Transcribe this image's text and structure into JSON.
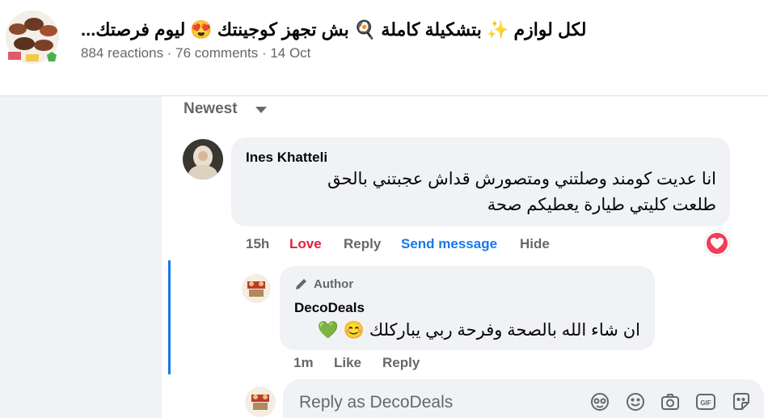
{
  "post": {
    "title": "لكل لوازم ✨ بتشكيلة كاملة 🍳 بش تجهز كوجينتك 😍 ليوم فرصتك...",
    "meta": "884 reactions · 76 comments · 14 Oct"
  },
  "sort": {
    "label": "Newest"
  },
  "comment": {
    "author": "Ines Khatteli",
    "text_line1": "انا عديت كومند وصلتني ومتصورش قداش عجبتني بالحق",
    "text_line2": "طلعت كليتي طيارة يعطيكم صحة",
    "time": "15h",
    "love_label": "Love",
    "reply_label": "Reply",
    "send_message_label": "Send message",
    "hide_label": "Hide",
    "reaction_icon": "heart-icon",
    "reaction_color": "#f33e58"
  },
  "reply": {
    "badge": "Author",
    "author": "DecoDeals",
    "text": "ان شاء الله بالصحة وفرحة ربي يباركلك 😊 💚",
    "time": "1m",
    "like_label": "Like",
    "reply_label": "Reply"
  },
  "composer": {
    "placeholder": "Reply as DecoDeals",
    "icons": [
      "avatar-sticker-icon",
      "emoji-icon",
      "camera-icon",
      "gif-icon",
      "sticker-icon"
    ]
  },
  "colors": {
    "accent": "#1877f2",
    "love": "#e41e3f",
    "text_secondary": "#65676b",
    "bubble": "#f0f2f5"
  }
}
